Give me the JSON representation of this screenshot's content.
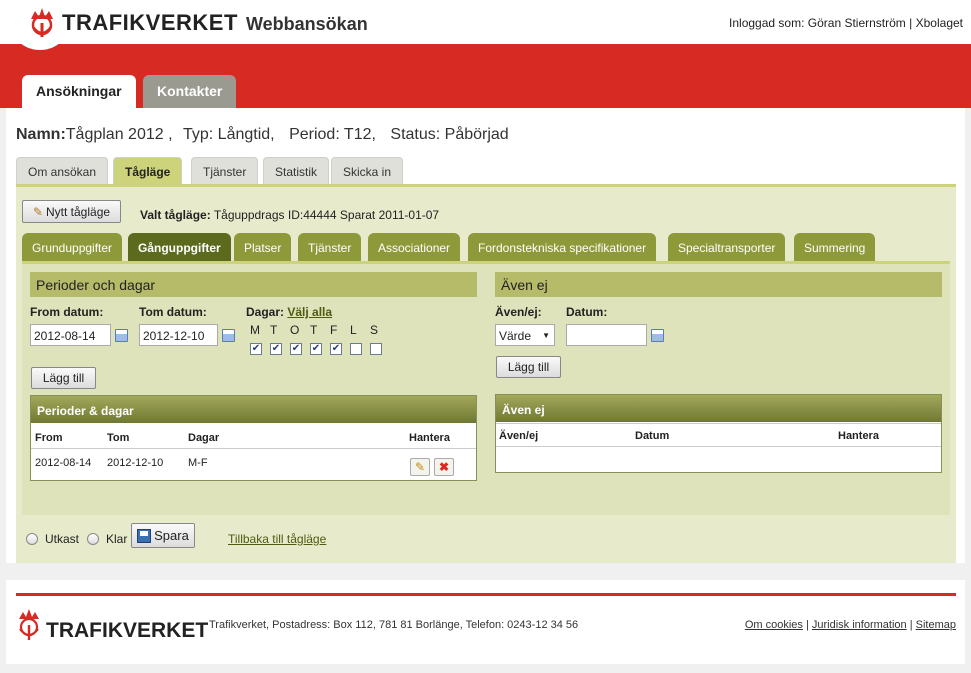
{
  "header": {
    "logo_text": "TRAFIKVERKET",
    "app_title": "Webbansökan",
    "login_label": "Inloggad som:",
    "user": "Göran Stiernström",
    "separator": "|",
    "org": "Xbolaget"
  },
  "main_tabs": [
    "Ansökningar",
    "Kontakter"
  ],
  "name_row": {
    "name_label": "Namn:",
    "name": "Tågplan 2012 ,",
    "type": "Typ: Långtid,",
    "period": "Period: T12,",
    "status": "Status: Påbörjad"
  },
  "sub_tabs": [
    "Om ansökan",
    "Tågläge",
    "Tjänster",
    "Statistik",
    "Skicka in"
  ],
  "toolbar": {
    "new_button": "Nytt tågläge",
    "selected_label": "Valt tågläge:",
    "selected_value": "Tåguppdrags ID:44444 Sparat 2011-01-07"
  },
  "tag_tabs": [
    "Grunduppgifter",
    "Gånguppgifter",
    "Platser",
    "Tjänster",
    "Associationer",
    "Fordonstekniska specifikationer",
    "Specialtransporter",
    "Summering"
  ],
  "periods": {
    "title": "Perioder och dagar",
    "from_label": "From datum:",
    "from_value": "2012-08-14",
    "to_label": "Tom datum:",
    "to_value": "2012-12-10",
    "days_label": "Dagar:",
    "select_all": "Välj alla",
    "day_letters": [
      "M",
      "T",
      "O",
      "T",
      "F",
      "L",
      "S"
    ],
    "day_checked": [
      true,
      true,
      true,
      true,
      true,
      false,
      false
    ],
    "add_button": "Lägg till",
    "table_title": "Perioder & dagar",
    "columns": [
      "From",
      "Tom",
      "Dagar",
      "Hantera"
    ],
    "rows": [
      {
        "from": "2012-08-14",
        "to": "2012-12-10",
        "days": "M-F"
      }
    ]
  },
  "aven_ej": {
    "title": "Även ej",
    "type_label": "Även/ej:",
    "type_value": "Värde",
    "date_label": "Datum:",
    "date_value": "",
    "add_button": "Lägg till",
    "table_title": "Även ej",
    "columns": [
      "Även/ej",
      "Datum",
      "Hantera"
    ]
  },
  "bottom": {
    "draft_label": "Utkast",
    "done_label": "Klar",
    "save_button": "Spara",
    "back_link": "Tillbaka till tågläge"
  },
  "footer": {
    "logo_text": "TRAFIKVERKET",
    "address": "Trafikverket, Postadress: Box 112, 781 81 Borlänge, Telefon: 0243-12 34 56",
    "links": [
      "Om cookies",
      "Juridisk information",
      "Sitemap"
    ],
    "separator": "|"
  },
  "colors": {
    "brand_red": "#d72a22",
    "active_tab": "#5c6a1e",
    "tab": "#8e9a3a",
    "subtab_active": "#cdd37a"
  }
}
